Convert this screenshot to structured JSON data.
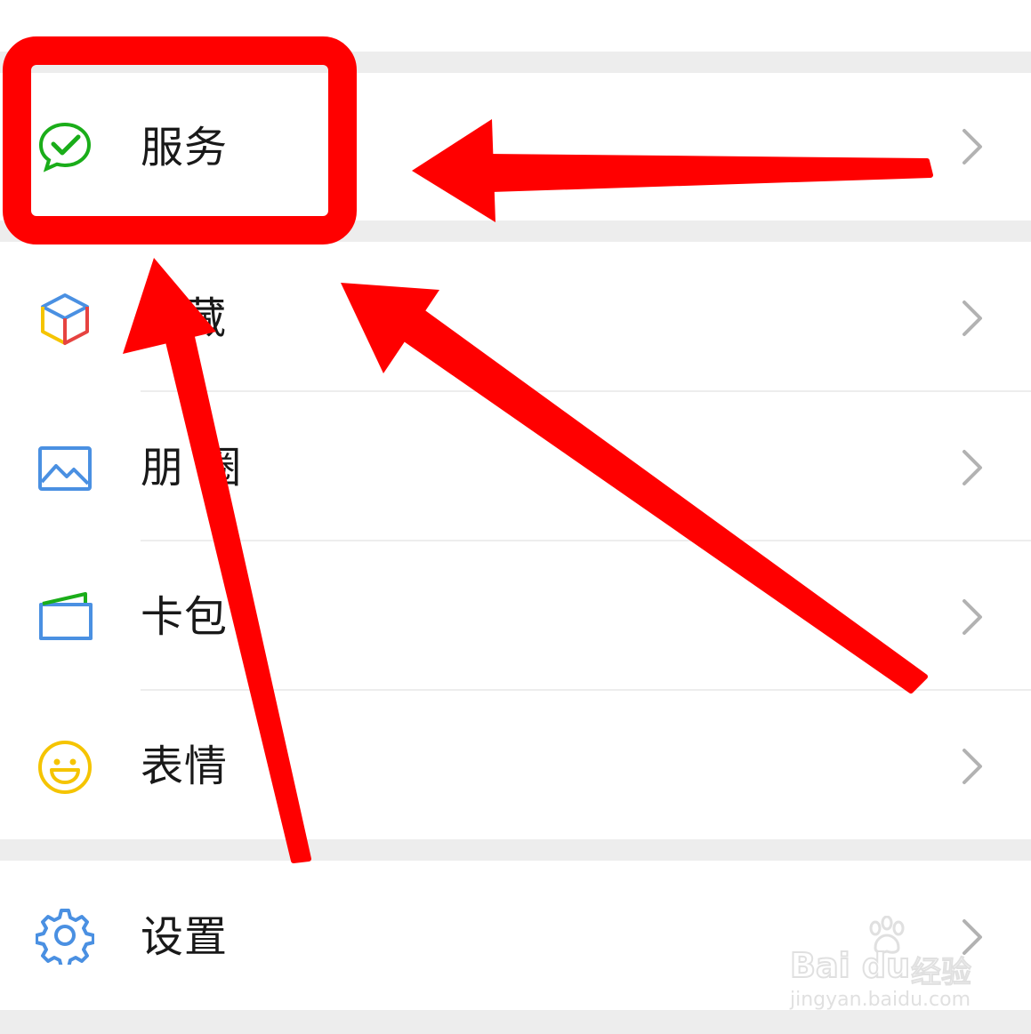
{
  "menu": {
    "items": [
      {
        "label": "服务",
        "icon": "wechat-pay-icon"
      },
      {
        "label": "藏",
        "icon": "favorites-cube-icon"
      },
      {
        "label": "朋 圈",
        "icon": "moments-image-icon"
      },
      {
        "label": "卡包",
        "icon": "card-wallet-icon"
      },
      {
        "label": "表情",
        "icon": "sticker-smiley-icon"
      },
      {
        "label": "设置",
        "icon": "settings-gear-icon"
      }
    ]
  },
  "annotation": {
    "color": "#ff0000",
    "highlight": "服务"
  },
  "watermark": {
    "brand": "Bai du",
    "sub": "经验",
    "url": "jingyan.baidu.com"
  }
}
